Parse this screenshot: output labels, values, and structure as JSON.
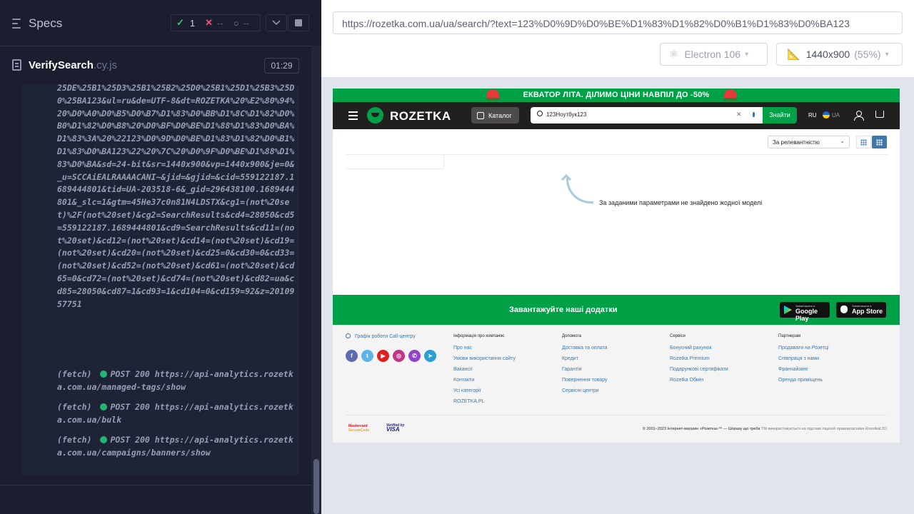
{
  "runner": {
    "title": "Specs",
    "stats": {
      "passed": "1",
      "failed": "--",
      "pending": "--"
    },
    "spec": {
      "name": "VerifySearch",
      "ext": ".cy.js",
      "duration": "01:29"
    },
    "log": {
      "request_url_tail": "25DE%25B1%25D3%25B1%25B2%25D0%25B1%25D1%25B3%25D0%25BA123&ul=ru&de=UTF-8&dt=ROZETKA%20%E2%80%94%20%D0%A0%D0%B5%D0%B7%D1%83%D0%BB%D1%8C%D1%82%D0%B0%D1%82%D0%B8%20%D0%BF%D0%BE%D1%88%D1%83%D0%BA%D1%83%3A%20%22123%D0%9D%D0%BE%D1%83%D1%82%D0%B1%D1%83%D0%BA123%22%20%7C%20%D0%9F%D0%BE%D1%88%D1%83%D0%BA&sd=24-bit&sr=1440x900&vp=1440x900&je=0&_u=SCCAiEALRAAAACANI~&jid=&gjid=&cid=559122187.1689444801&tid=UA-203518-6&_gid=296438100.1689444801&_slc=1&gtm=45He37c0n81N4LDSTX&cg1=(not%20set)%2F(not%20set)&cg2=SearchResults&cd4=28050&cd5=559122187.1689444801&cd9=SearchResults&cd11=(not%20set)&cd12=(not%20set)&cd14=(not%20set)&cd19=(not%20set)&cd20=(not%20set)&cd25=0&cd30=0&cd33=(not%20set)&cd52=(not%20set)&cd61=(not%20set)&cd65=0&cd72=(not%20set)&cd74=(not%20set)&cd82=ua&cd85=28050&cd87=1&cd93=1&cd104=0&cd159=92&z=2010957751",
      "fetches": [
        {
          "tag": "(fetch)",
          "status": "POST 200",
          "url": "https://api-analytics.rozetka.com.ua/managed-tags/show"
        },
        {
          "tag": "(fetch)",
          "status": "POST 200",
          "url": "https://api-analytics.rozetka.com.ua/bulk"
        },
        {
          "tag": "(fetch)",
          "status": "POST 200",
          "url": "https://api-analytics.rozetka.com.ua/campaigns/banners/show"
        }
      ]
    }
  },
  "browser": {
    "url": "https://rozetka.com.ua/ua/search/?text=123%D0%9D%D0%BE%D1%83%D1%82%D0%B1%D1%83%D0%BA123",
    "name": "Electron 106",
    "viewport": "1440x900",
    "scale": "(55%)"
  },
  "site": {
    "promo": "ЕКВАТОР ЛІТА. ДІЛИМО ЦІНИ НАВПІЛ ДО -50%",
    "logo": "ROZETKA",
    "catalog": "Каталог",
    "search_query": "123Ноутбук123",
    "search_button": "Знайти",
    "lang_ru": "RU",
    "lang_ua": "UA",
    "sort": "За релевантністю",
    "empty": "За заданими параметрами не знайдено жодної моделі",
    "apps_title": "Завантажуйте наші додатки",
    "gplay_small": "Завантажити в",
    "gplay_big": "Google Play",
    "appstore_small": "Завантажити в",
    "appstore_big": "App Store",
    "schedule": "Графік роботи Call-центру",
    "footer_cols": [
      {
        "title": "Інформація про компанію",
        "links": [
          "Про нас",
          "Умови використання сайту",
          "Вакансії",
          "Контакти",
          "Усі категорії",
          "ROZETKA.PL"
        ]
      },
      {
        "title": "Допомога",
        "links": [
          "Доставка та оплата",
          "Кредит",
          "Гарантія",
          "Повернення товару",
          "Сервісні центри"
        ]
      },
      {
        "title": "Сервіси",
        "links": [
          "Бонусний рахунок",
          "Rozetka Premium",
          "Подарункові сертифікати",
          "Rozetka Обмін"
        ]
      },
      {
        "title": "Партнерам",
        "links": [
          "Продавати на Розетці",
          "Співпраця з нами",
          "Франчайзинг",
          "Оренда приміщень"
        ]
      }
    ],
    "mastercard": [
      "Mastercard",
      "SecureCode"
    ],
    "visa": [
      "Verified by",
      "VISA"
    ],
    "copyright": "© 2001–2023 Інтернет-магазин «Розетка»™ — Шоразу що треба",
    "copyright_tm": "ТМ використовується на підставі ліцензії правовласника RozetkaLTD"
  }
}
